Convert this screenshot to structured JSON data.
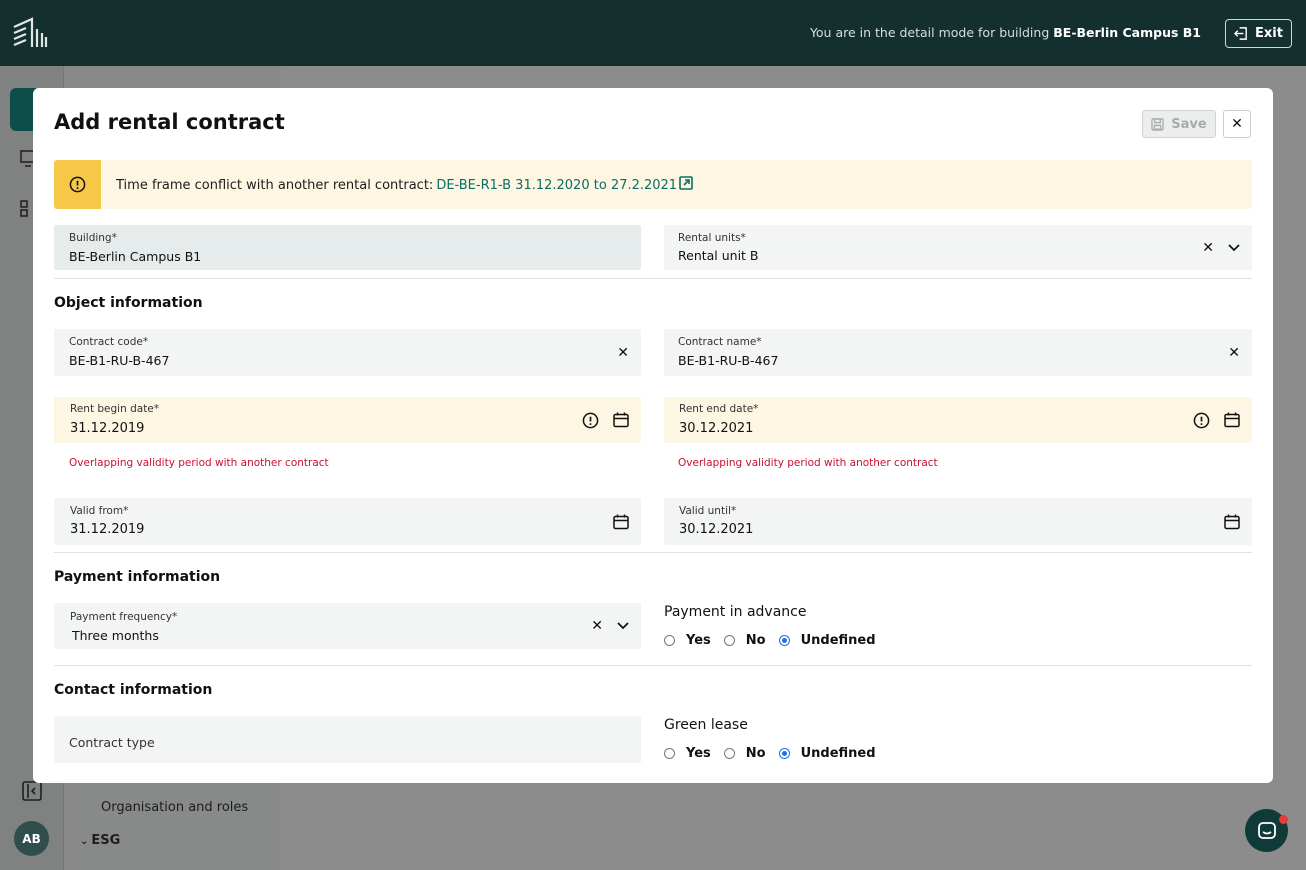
{
  "topbar": {
    "detail_prefix": "You are in the detail mode for building",
    "building_name": "BE-Berlin Campus B1",
    "exit_label": "Exit"
  },
  "background": {
    "avatar_initials": "AB",
    "nav_org": "Organisation and roles",
    "nav_esg": "ESG"
  },
  "modal": {
    "title": "Add rental contract",
    "save_label": "Save",
    "alert": {
      "text": "Time frame conflict with another rental contract:",
      "link": "DE-BE-R1-B 31.12.2020 to 27.2.2021"
    },
    "building": {
      "label": "Building*",
      "value": "BE-Berlin Campus B1"
    },
    "rental_units": {
      "label": "Rental units*",
      "value": "Rental unit B"
    },
    "object_section": "Object information",
    "contract_code": {
      "label": "Contract code*",
      "value": "BE-B1-RU-B-467"
    },
    "contract_name": {
      "label": "Contract name*",
      "value": "BE-B1-RU-B-467"
    },
    "rent_begin": {
      "label": "Rent begin date*",
      "value": "31.12.2019",
      "error": "Overlapping validity period with another contract"
    },
    "rent_end": {
      "label": "Rent end date*",
      "value": "30.12.2021",
      "error": "Overlapping validity period with another contract"
    },
    "valid_from": {
      "label": "Valid from*",
      "value": "31.12.2019"
    },
    "valid_until": {
      "label": "Valid until*",
      "value": "30.12.2021"
    },
    "payment_section": "Payment information",
    "payment_frequency": {
      "label": "Payment frequency*",
      "value": "Three months"
    },
    "payment_advance": {
      "title": "Payment in advance",
      "options": [
        "Yes",
        "No",
        "Undefined"
      ],
      "selected": "Undefined"
    },
    "contact_section": "Contact information",
    "contract_type": {
      "placeholder": "Contract type"
    },
    "green_lease": {
      "title": "Green lease",
      "options": [
        "Yes",
        "No",
        "Undefined"
      ],
      "selected": "Undefined"
    }
  },
  "colors": {
    "topbar": "#14302e",
    "accent": "#0b6e64",
    "warning": "#f7c848",
    "warning_bg": "#fdf6e3",
    "error": "#c8102e",
    "radio_selected": "#1a73e8"
  },
  "icons": [
    "building-logo-icon",
    "exit-icon",
    "save-icon",
    "close-icon",
    "warning-icon",
    "external-link-icon",
    "clear-icon",
    "chevron-down-icon",
    "calendar-icon",
    "chat-icon",
    "collapse-icon"
  ]
}
